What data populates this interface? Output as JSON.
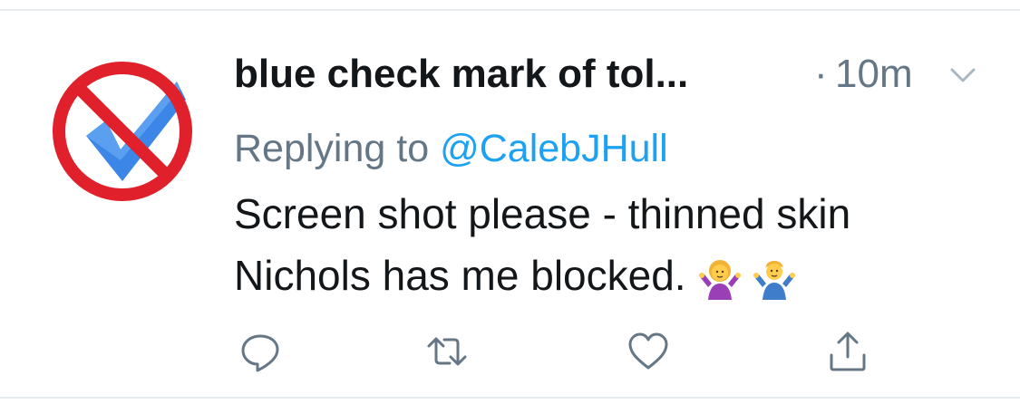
{
  "tweet": {
    "avatar_icon": "no-blue-check-icon",
    "display_name": "blue check mark of tol...",
    "dot": "·",
    "timestamp": "10m",
    "reply_prefix": "Replying to ",
    "reply_handle": "@CalebJHull",
    "text_line_1": "Screen shot please - thinned skin",
    "text_line_2": "Nichols has me blocked.",
    "emojis": [
      "woman-shrugging-icon",
      "man-shrugging-icon"
    ]
  },
  "actions": {
    "icons": [
      "reply-icon",
      "retweet-icon",
      "like-icon",
      "share-icon"
    ]
  },
  "colors": {
    "name": "#14171a",
    "secondary": "#657786",
    "link": "#1da1f2",
    "divider": "#e6ecf0",
    "prohibit_red": "#e0202a",
    "check_blue": "#3b86e6"
  }
}
